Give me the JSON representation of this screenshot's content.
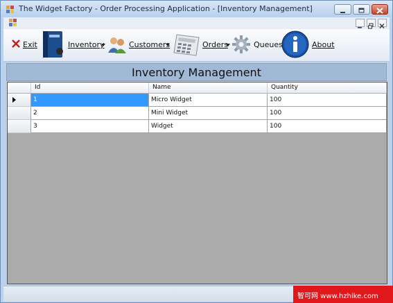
{
  "window": {
    "title": "The Widget Factory - Order Processing Application - [Inventory Management]"
  },
  "toolbar": {
    "exit_label": "Exit",
    "inventory_label": "Inventory",
    "customers_label": "Customers",
    "orders_label": "Orders",
    "queues_label": "Queues",
    "about_label": "About"
  },
  "page": {
    "heading": "Inventory Management"
  },
  "grid": {
    "columns": [
      "Id",
      "Name",
      "Quantity"
    ],
    "rows": [
      {
        "id": "1",
        "name": "Micro Widget",
        "quantity": "100"
      },
      {
        "id": "2",
        "name": "Mini Widget",
        "quantity": "100"
      },
      {
        "id": "3",
        "name": "Widget",
        "quantity": "100"
      }
    ],
    "current_row_index": 0
  },
  "watermark": {
    "text": "智可网 www.hzhike.com"
  },
  "colors": {
    "selection": "#3399ff",
    "empty_grid": "#ababab",
    "banner": "#a2b9d5",
    "watermark": "#e0181b"
  }
}
